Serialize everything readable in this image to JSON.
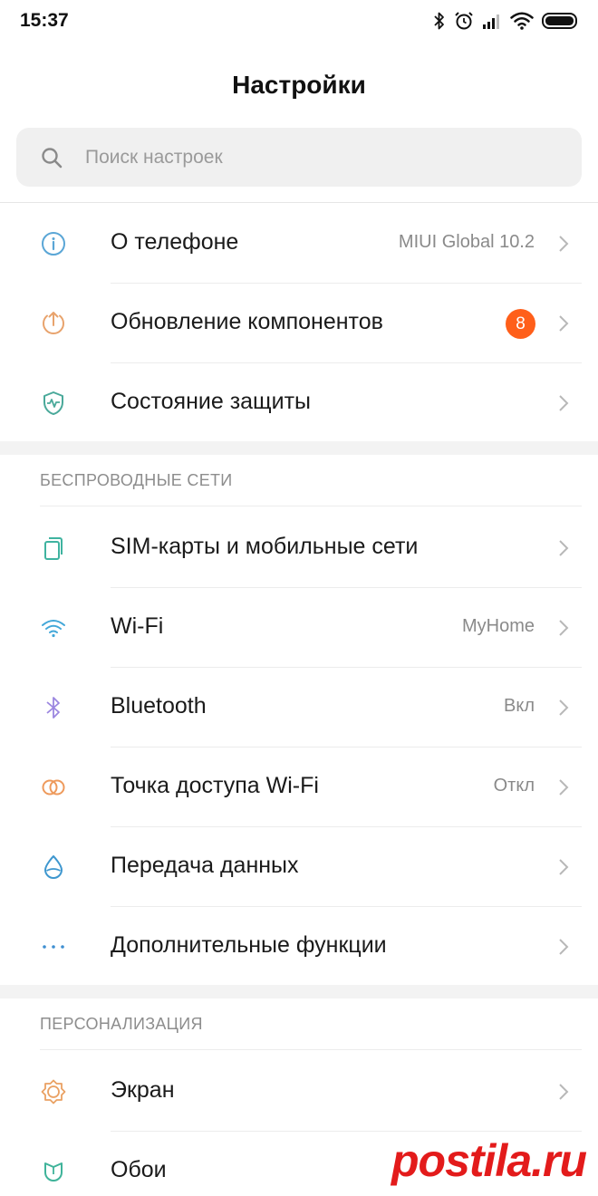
{
  "status_bar": {
    "time": "15:37",
    "icons": [
      "bluetooth-icon",
      "alarm-icon",
      "signal-icon",
      "wifi-icon",
      "battery-icon"
    ]
  },
  "header": {
    "title": "Настройки"
  },
  "search": {
    "placeholder": "Поиск настроек"
  },
  "sections": [
    {
      "title": "",
      "items": [
        {
          "label": "О телефоне",
          "value": "MIUI Global 10.2",
          "icon": "info-icon"
        },
        {
          "label": "Обновление компонентов",
          "badge": "8",
          "icon": "update-icon"
        },
        {
          "label": "Состояние защиты",
          "icon": "shield-icon"
        }
      ]
    },
    {
      "title": "БЕСПРОВОДНЫЕ СЕТИ",
      "items": [
        {
          "label": "SIM-карты и мобильные сети",
          "icon": "sim-card-icon"
        },
        {
          "label": "Wi-Fi",
          "value": "MyHome",
          "icon": "wifi-icon"
        },
        {
          "label": "Bluetooth",
          "value": "Вкл",
          "icon": "bluetooth-icon"
        },
        {
          "label": "Точка доступа Wi-Fi",
          "value": "Откл",
          "icon": "hotspot-icon"
        },
        {
          "label": "Передача данных",
          "icon": "data-usage-icon"
        },
        {
          "label": "Дополнительные функции",
          "icon": "more-icon"
        }
      ]
    },
    {
      "title": "ПЕРСОНАЛИЗАЦИЯ",
      "items": [
        {
          "label": "Экран",
          "icon": "display-icon"
        },
        {
          "label": "Обои",
          "icon": "wallpaper-icon"
        }
      ]
    }
  ],
  "watermark": {
    "text": "postila.ru"
  },
  "colors": {
    "badge": "#ff5f1a",
    "info_icon": "#5aa6d6",
    "update_icon": "#e8a36d",
    "shield_icon": "#4aa99a",
    "sim_icon": "#3fb3a0",
    "wifi_icon": "#42a7d8",
    "bluetooth_icon": "#9b86e0",
    "hotspot_icon": "#ee9a5c",
    "data_icon": "#3e97cf",
    "more_icon": "#3e8fd1",
    "display_icon": "#eaa163",
    "wallpaper_icon": "#3fb39a",
    "watermark": "#e31b1b"
  }
}
